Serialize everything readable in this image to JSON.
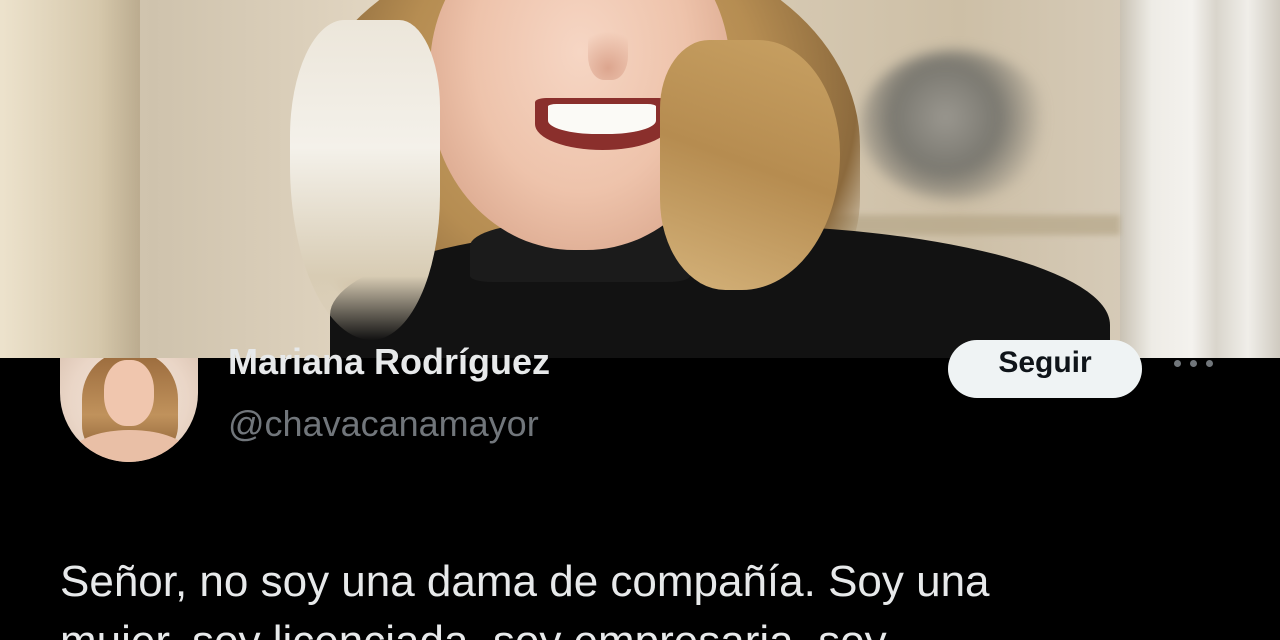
{
  "header_image": {
    "icon": "photo-woman-smiling"
  },
  "tweet": {
    "author": {
      "display_name": "Mariana Rodríguez",
      "handle": "@chavacanamayor",
      "avatar_icon": "profile-photo"
    },
    "follow_label": "Seguir",
    "more_icon": "more-horizontal-icon",
    "text_line_1": "Señor, no soy una dama de compañía. Soy una",
    "text_line_2": "mujer, soy licenciada, soy empresaria, soy"
  },
  "colors": {
    "background": "#000000",
    "text_primary": "#e7e9ea",
    "text_secondary": "#71767b",
    "button_bg": "#eff3f4",
    "button_text": "#0f1419"
  }
}
